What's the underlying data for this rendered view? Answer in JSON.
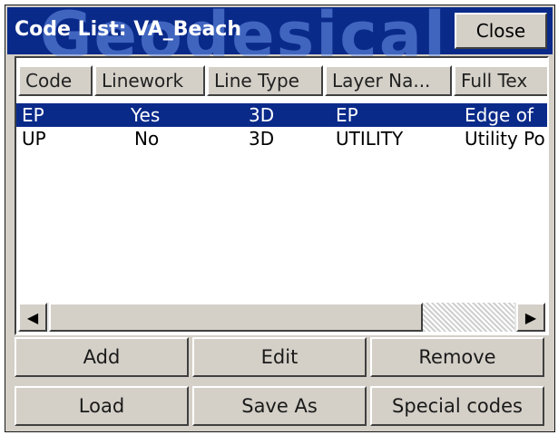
{
  "window": {
    "title": "Code List: VA_Beach",
    "watermark": "Geodesical",
    "close_label": "Close"
  },
  "list": {
    "columns": [
      "Code",
      "Linework",
      "Line Type",
      "Layer Na...",
      "Full Tex"
    ],
    "rows": [
      {
        "code": "EP",
        "linework": "Yes",
        "line_type": "3D",
        "layer": "EP",
        "full_text": "Edge of",
        "selected": true
      },
      {
        "code": "UP",
        "linework": "No",
        "line_type": "3D",
        "layer": "UTILITY",
        "full_text": "Utility Po",
        "selected": false
      }
    ]
  },
  "scrollbar": {
    "left_arrow": "◀",
    "right_arrow": "▶"
  },
  "buttons": {
    "add": "Add",
    "edit": "Edit",
    "remove": "Remove",
    "load": "Load",
    "save_as": "Save As",
    "special_codes": "Special codes"
  },
  "colors": {
    "titlebar": "#0a2a8a",
    "selection": "#0a2a8a",
    "face": "#d4d0c8"
  }
}
